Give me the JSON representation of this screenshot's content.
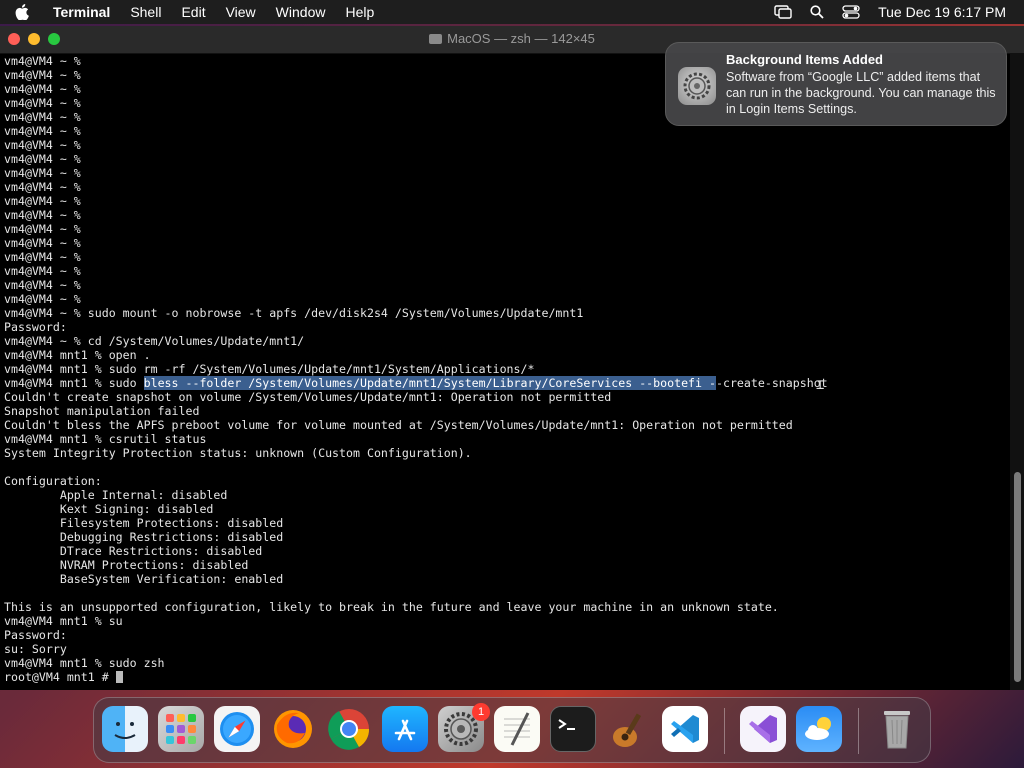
{
  "menubar": {
    "app_name": "Terminal",
    "items": [
      "Shell",
      "Edit",
      "View",
      "Window",
      "Help"
    ],
    "clock": "Tue Dec 19  6:17 PM"
  },
  "window": {
    "title": "MacOS — zsh — 142×45"
  },
  "terminal": {
    "lines": [
      "vm4@VM4 ~ %",
      "vm4@VM4 ~ %",
      "vm4@VM4 ~ %",
      "vm4@VM4 ~ %",
      "vm4@VM4 ~ %",
      "vm4@VM4 ~ %",
      "vm4@VM4 ~ %",
      "vm4@VM4 ~ %",
      "vm4@VM4 ~ %",
      "vm4@VM4 ~ %",
      "vm4@VM4 ~ %",
      "vm4@VM4 ~ %",
      "vm4@VM4 ~ %",
      "vm4@VM4 ~ %",
      "vm4@VM4 ~ %",
      "vm4@VM4 ~ %",
      "vm4@VM4 ~ %",
      "vm4@VM4 ~ %",
      "vm4@VM4 ~ % sudo mount -o nobrowse -t apfs /dev/disk2s4 /System/Volumes/Update/mnt1",
      "Password:",
      "vm4@VM4 ~ % cd /System/Volumes/Update/mnt1/",
      "vm4@VM4 mnt1 % open .",
      "vm4@VM4 mnt1 % sudo rm -rf /System/Volumes/Update/mnt1/System/Applications/*"
    ],
    "bless_line": {
      "prefix": "vm4@VM4 mnt1 % sudo ",
      "selected": "bless --folder /System/Volumes/Update/mnt1/System/Library/CoreServices --bootefi -",
      "suffix": "-create-snapshot"
    },
    "lines_after": [
      "Couldn't create snapshot on volume /System/Volumes/Update/mnt1: Operation not permitted",
      "Snapshot manipulation failed",
      "Couldn't bless the APFS preboot volume for volume mounted at /System/Volumes/Update/mnt1: Operation not permitted",
      "vm4@VM4 mnt1 % csrutil status",
      "System Integrity Protection status: unknown (Custom Configuration).",
      "",
      "Configuration:",
      "        Apple Internal: disabled",
      "        Kext Signing: disabled",
      "        Filesystem Protections: disabled",
      "        Debugging Restrictions: disabled",
      "        DTrace Restrictions: disabled",
      "        NVRAM Protections: disabled",
      "        BaseSystem Verification: enabled",
      "",
      "This is an unsupported configuration, likely to break in the future and leave your machine in an unknown state.",
      "vm4@VM4 mnt1 % su",
      "Password:",
      "su: Sorry",
      "vm4@VM4 mnt1 % sudo zsh"
    ],
    "prompt": "root@VM4 mnt1 # "
  },
  "notification": {
    "title": "Background Items Added",
    "body": "Software from “Google LLC” added items that can run in the background. You can manage this in Login Items Settings."
  },
  "dock": {
    "settings_badge": "1",
    "items": [
      "finder-icon",
      "launchpad-icon",
      "safari-icon",
      "firefox-icon",
      "chrome-icon",
      "app-store-icon",
      "system-settings-icon",
      "textedit-icon",
      "terminal-icon",
      "garageband-icon",
      "vscode-icon",
      "visual-studio-icon",
      "weather-icon",
      "trash-icon"
    ]
  },
  "colors": {
    "selection": "#3b5f8f",
    "terminal_bg": "#000000",
    "badge": "#ff3b30"
  }
}
